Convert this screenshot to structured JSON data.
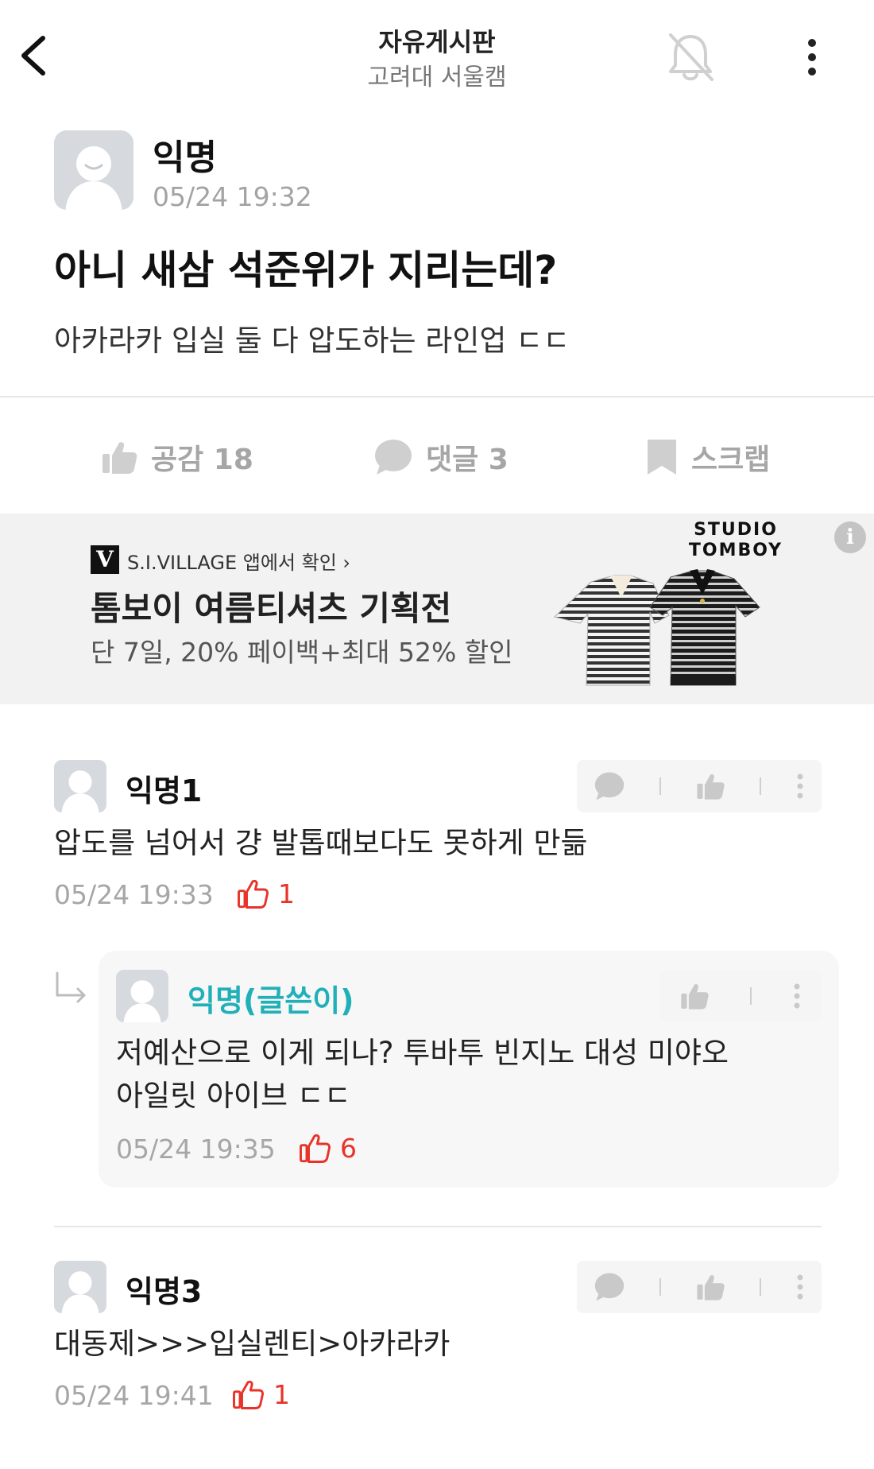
{
  "header": {
    "title": "자유게시판",
    "subtitle": "고려대 서울캠"
  },
  "post": {
    "author": "익명",
    "time": "05/24 19:32",
    "title": "아니 새삼 석준위가 지리는데?",
    "body": "아카라카 입실 둘 다 압도하는 라인업 ㄷㄷ",
    "actions": {
      "like_label": "공감 18",
      "comment_label": "댓글 3",
      "scrap_label": "스크랩"
    }
  },
  "ad": {
    "source": "S.I.VILLAGE 앱에서 확인 ›",
    "logo_letter": "V",
    "title": "톰보이 여름티셔츠 기획전",
    "description": "단 7일, 20% 페이백+최대 52% 할인",
    "brand_line1": "STUDIO",
    "brand_line2": "TOMBOY",
    "info_icon": "i"
  },
  "comments": [
    {
      "author": "익명1",
      "body": "압도를 넘어서 걍 발톱때보다도 못하게 만듦",
      "time": "05/24 19:33",
      "likes": "1",
      "replies": [
        {
          "author": "익명(글쓴이)",
          "body_line1": "저예산으로 이게 되나? 투바투 빈지노 대성 미야오",
          "body_line2": "아일릿 아이브 ㄷㄷ",
          "time": "05/24 19:35",
          "likes": "6"
        }
      ]
    },
    {
      "author": "익명3",
      "body": "대동제>>>입실렌티>아카라카",
      "time": "05/24 19:41",
      "likes": "1"
    }
  ],
  "colors": {
    "accent_op": "#21b0b8",
    "like_red": "#e8332a",
    "muted_gray": "#a6a6a6"
  }
}
